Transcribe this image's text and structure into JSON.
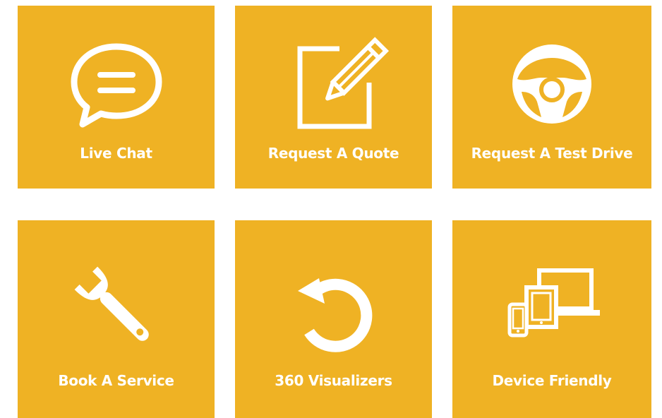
{
  "tiles": [
    {
      "label": "Live Chat",
      "icon": "chat-bubble-icon"
    },
    {
      "label": "Request A Quote",
      "icon": "edit-document-icon"
    },
    {
      "label": "Request A Test Drive",
      "icon": "steering-wheel-icon"
    },
    {
      "label": "Book A Service",
      "icon": "wrench-icon"
    },
    {
      "label": "360 Visualizers",
      "icon": "rotate-icon"
    },
    {
      "label": "Device Friendly",
      "icon": "devices-icon"
    }
  ],
  "colors": {
    "tile_background": "#efb224",
    "foreground": "#ffffff",
    "page_background": "#ffffff"
  }
}
